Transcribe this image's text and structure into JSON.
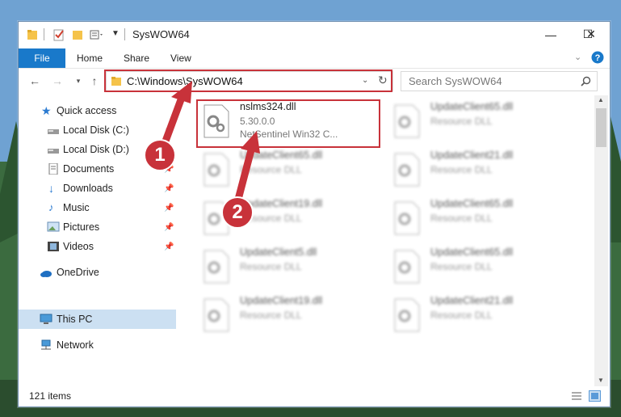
{
  "window": {
    "title": "SysWOW64",
    "controls": {
      "minimize": "—",
      "maximize": "☐",
      "close": "✕"
    }
  },
  "ribbon": {
    "tabs": [
      {
        "label": "File",
        "active": true
      },
      {
        "label": "Home"
      },
      {
        "label": "Share"
      },
      {
        "label": "View"
      }
    ]
  },
  "nav": {
    "address": "C:\\Windows\\SysWOW64",
    "search_placeholder": "Search SysWOW64"
  },
  "sidebar": {
    "items": [
      {
        "label": "Quick access",
        "icon": "star-icon",
        "pinned": false
      },
      {
        "label": "Local Disk (C:)",
        "icon": "drive-icon",
        "pinned": true
      },
      {
        "label": "Local Disk (D:)",
        "icon": "drive-icon",
        "pinned": true
      },
      {
        "label": "Documents",
        "icon": "documents-icon",
        "pinned": true
      },
      {
        "label": "Downloads",
        "icon": "downloads-icon",
        "pinned": true
      },
      {
        "label": "Music",
        "icon": "music-icon",
        "pinned": true
      },
      {
        "label": "Pictures",
        "icon": "pictures-icon",
        "pinned": true
      },
      {
        "label": "Videos",
        "icon": "videos-icon",
        "pinned": true
      },
      {
        "label": "OneDrive",
        "icon": "cloud-icon"
      },
      {
        "label": "This PC",
        "icon": "computer-icon",
        "selected": true
      },
      {
        "label": "Network",
        "icon": "network-icon"
      }
    ]
  },
  "files": {
    "highlighted": {
      "name": "nslms324.dll",
      "version": "5.30.0.0",
      "description": "NetSentinel Win32 C..."
    },
    "others": [
      {
        "name": "UpdateClient65.dll",
        "type": "Resource DLL"
      },
      {
        "name": "UpdateClient65.dll",
        "type": "Resource DLL"
      },
      {
        "name": "UpdateClient21.dll",
        "type": "Resource DLL"
      },
      {
        "name": "UpdateClient19.dll",
        "type": "Resource DLL"
      },
      {
        "name": "UpdateClient65.dll",
        "type": "Resource DLL"
      },
      {
        "name": "UpdateClient5.dll",
        "type": "Resource DLL"
      },
      {
        "name": "UpdateClient65.dll",
        "type": "Resource DLL"
      },
      {
        "name": "UpdateClient19.dll",
        "type": "Resource DLL"
      },
      {
        "name": "UpdateClient21.dll",
        "type": "Resource DLL"
      }
    ]
  },
  "status": {
    "item_count": "121 items"
  },
  "annotations": {
    "step1": "1",
    "step2": "2"
  },
  "colors": {
    "accent": "#1979ca",
    "highlight": "#c8323a",
    "selected": "#cce0f2"
  }
}
